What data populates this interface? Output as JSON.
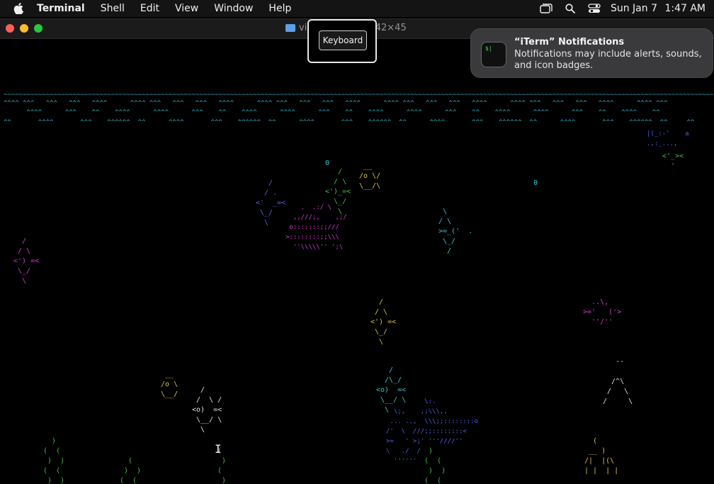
{
  "menubar": {
    "app_name": "Terminal",
    "items": [
      "Shell",
      "Edit",
      "View",
      "Window",
      "Help"
    ],
    "date": "Sun Jan 7",
    "time": "1:47 AM"
  },
  "window": {
    "title_prefix": "vi",
    "title_suffix": "um — 142×45"
  },
  "keyboard_overlay": {
    "label": "Keyboard"
  },
  "notification": {
    "title": "“iTerm” Notifications",
    "body": "Notifications may include alerts, sounds, and icon badges.",
    "icon_text": "$|"
  },
  "terminal": {
    "wave_line_1": "~~~~~~~~~~~~~~~~~~~~~~~~~~~~~~~~~~~~~~~~~~~~~~~~~~~~~~~~~~~~~~~~~~~~~~~~~~~~~~~~~~~~~~~~~~~~~~~~~~~~~~~~~~~~~~~~~~~~~~~~~~~~~~~~~~~~~~~~~~~~~~~~~~~~~~~~~~~~~~~~~~~~~~~~~~~~~~~~~~~~~~~~~~~",
    "wave_line_2": "^^^^ ^^^   ^^^   ^^^   ^^^^      ^^^^ ^^^   ^^^   ^^^   ^^^^      ^^^^ ^^^   ^^^   ^^^   ^^^^      ^^^^ ^^^   ^^^   ^^^   ^^^^      ^^^^ ^^^   ^^^   ^^^   ^^^^      ^^^^ ^^^",
    "wave_line_3": "      ^^^^      ^^^    ^^    ^^^^      ^^^^      ^^^    ^^    ^^^^      ^^^^      ^^^    ^^    ^^^^      ^^^^      ^^^    ^^    ^^^^      ^^^^      ^^^    ^^    ^^^^    ^^",
    "wave_line_4": "^^       ^^^^       ^^^    ^^^^^^  ^^      ^^^^       ^^^    ^^^^^^  ^^      ^^^^       ^^^    ^^^^^^  ^^      ^^^^       ^^^    ^^^^^^  ^^      ^^^^       ^^^    ^^^^^^  ^^     ^^",
    "art": {
      "bubble_1": "0",
      "bubble_2": "0",
      "fish_a": "  __\n /o \\/\n \\__/\\",
      "fish_b": "   /\n  / \\\n<')_=<\n  \\_/\n   \\",
      "fish_c": "   /\n  / .\n<'  _=<\n \\_/\n  \\",
      "fish_d": "  /\n / \\\n<') =<\n \\_/\n  \\",
      "fish_e": " \\\n/ \\\n>=_('  .\n \\_/\n  /",
      "big_fish": "    .  .:/ \\\n  ,,///;,    ,;/\n o:::::::;;///\n>::::::::;;\\\\\\\n  ''\\\\\\\\\\'' ';\\",
      "fish_f": "  /\n / \\\n<') =<\n \\_/\n  \\",
      "fish_g": "  ..\\,\n>='   ('>\n  ''/''",
      "fish_h": "  __\n /o \\\n \\__/",
      "fish_i": "  /\n /  \\ /\n<o)  =<\n \\__/ \\\n  \\",
      "fish_j": "   /\n  /\\_/\n<o)  =<\n \\__/ \\\n  \\",
      "big_fish_2": "          \\:.\n  \\;,    ,;\\\\\\,,\n ... ..,  \\\\\\;;::::::::o\n/'  \\  ///;;::::::::<\n>=   ' >;' '''////''\n\\   ./  /\n  ''''''",
      "castle": "   --\n\n  /^\\\n /   \\\n/     \\",
      "castle_base": "  (\n __ )\n/|  |(\\\n| |  | |",
      "seaweed_1": "  )\n(  (\n )  )\n(  (\n )  )",
      "seaweed_2": "  (\n )  )\n(  (\n )",
      "seaweed_3": " (\n  )\n (\n  )",
      "seaweed_4": " )\n(  (\n )  )\n(  (",
      "small_fish_right": "<'_><\n  '",
      "topright_chars": "|(_:-'    a\n.,:_...,"
    }
  }
}
